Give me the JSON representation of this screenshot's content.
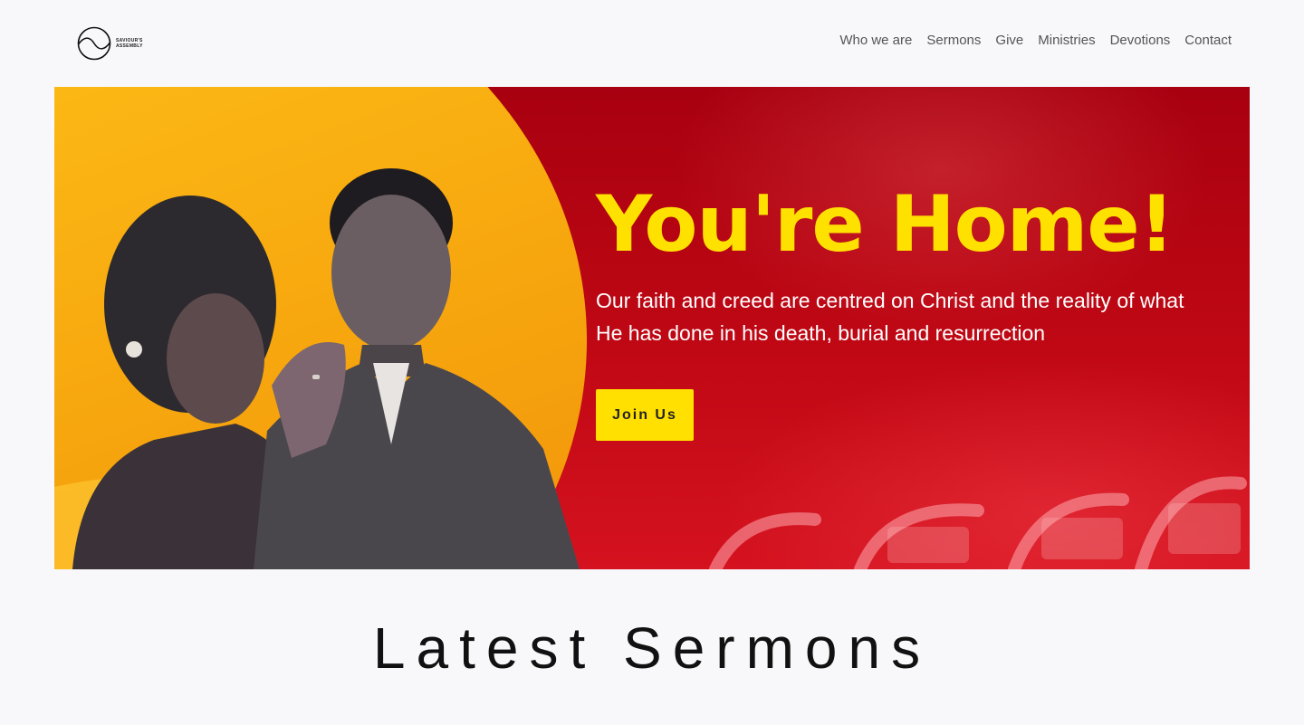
{
  "header": {
    "logo": {
      "line1": "SAVIOUR'S",
      "line2": "ASSEMBLY",
      "icon": "circle-wave-logo-icon"
    },
    "nav": [
      {
        "label": "Who we are"
      },
      {
        "label": "Sermons"
      },
      {
        "label": "Give"
      },
      {
        "label": "Ministries"
      },
      {
        "label": "Devotions"
      },
      {
        "label": "Contact"
      }
    ]
  },
  "hero": {
    "title": "You're Home!",
    "text": "Our faith and creed are centred on Christ and the reality of what He has done in his death, burial and resurrection",
    "button_label": "Join Us",
    "colors": {
      "title": "#ffe100",
      "background": "#c00814",
      "arc": "#ffc61a",
      "button": "#ffe000"
    }
  },
  "sermons": {
    "title": "Latest Sermons"
  }
}
